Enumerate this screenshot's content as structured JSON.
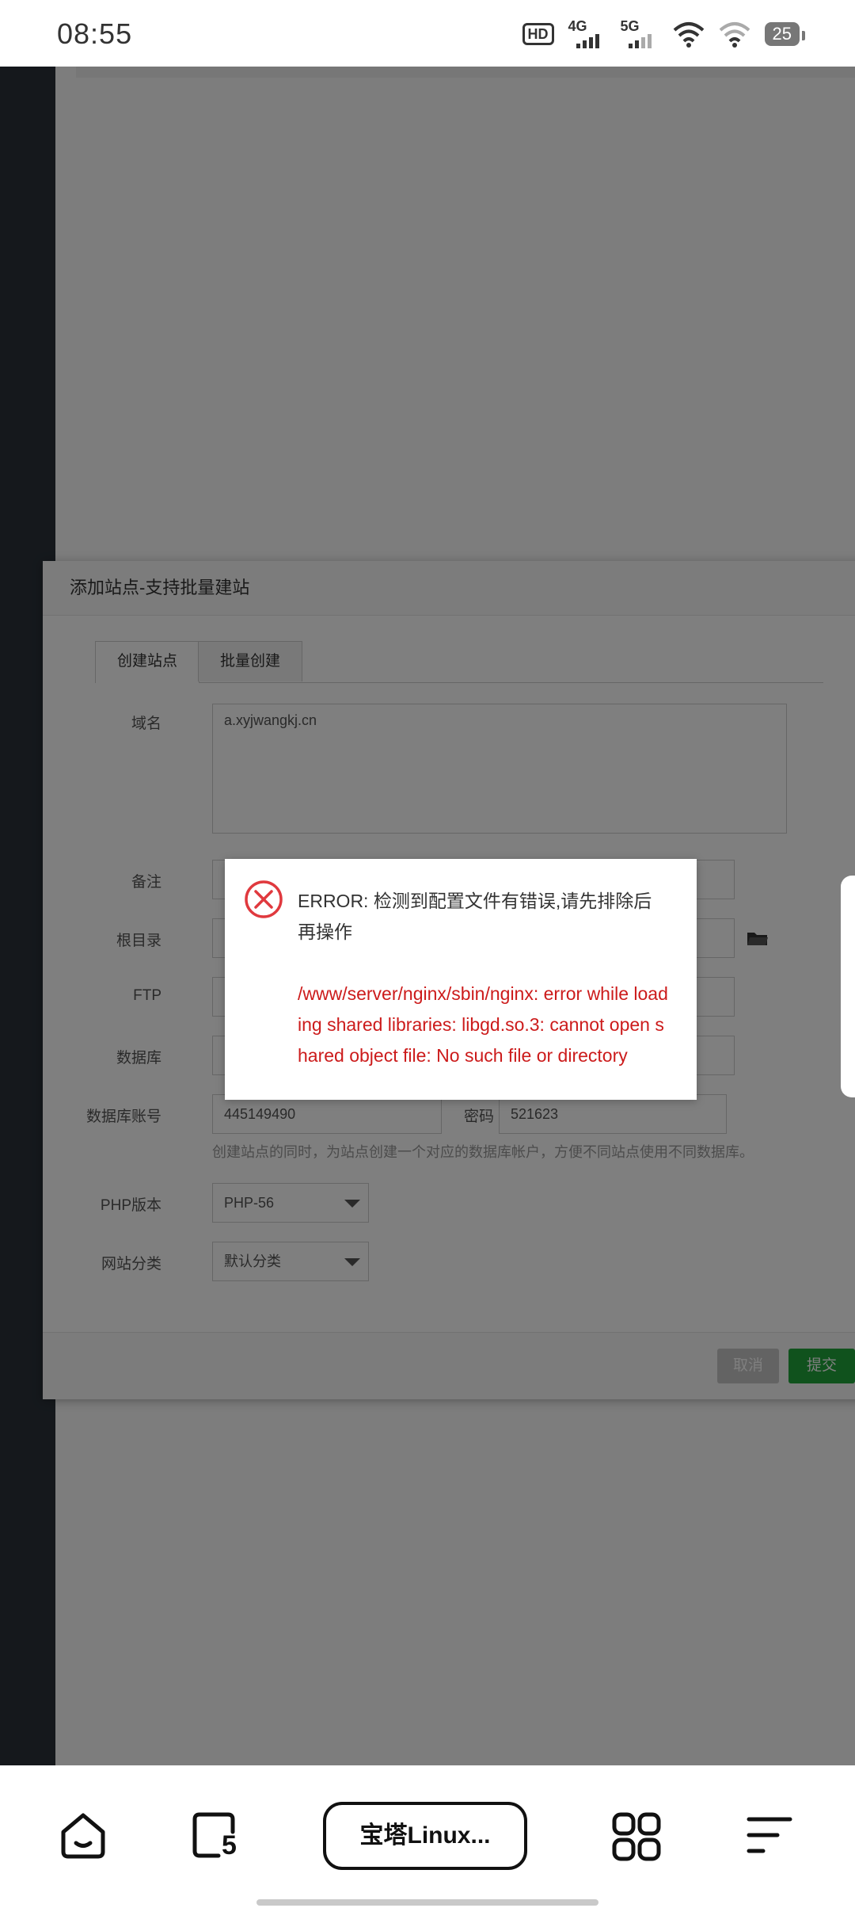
{
  "status_bar": {
    "time": "08:55",
    "hd_label": "HD",
    "net1": "4G",
    "net2": "5G",
    "battery": "25",
    "icons": [
      "hd-icon",
      "signal-4g-icon",
      "signal-5g-icon",
      "wifi-icon",
      "wifi-icon",
      "battery-icon"
    ]
  },
  "site_dialog": {
    "title": "添加站点-支持批量建站",
    "tabs": [
      {
        "label": "创建站点",
        "active": true
      },
      {
        "label": "批量创建",
        "active": false
      }
    ],
    "labels": {
      "domain": "域名",
      "note": "备注",
      "root": "根目录",
      "ftp": "FTP",
      "database": "数据库",
      "db_account": "数据库账号",
      "password": "密码",
      "php_version": "PHP版本",
      "category": "网站分类"
    },
    "values": {
      "domain": "a.xyjwangkj.cn",
      "db_account": "445149490",
      "password": "521623",
      "php_version": "PHP-56",
      "category": "默认分类"
    },
    "hint": "创建站点的同时，为站点创建一个对应的数据库帐户，方便不同站点使用不同数据库。",
    "buttons": {
      "cancel": "取消",
      "submit": "提交"
    }
  },
  "error_dialog": {
    "title": "ERROR: 检测到配置文件有错误,请先排除后再操作",
    "detail": "/www/server/nginx/sbin/nginx: error while loading shared libraries: libgd.so.3: cannot open shared object file: No such file or directory"
  },
  "bottom_nav": {
    "title_pill": "宝塔Linux...",
    "tab_count": "5"
  },
  "colors": {
    "accent_green": "#20a53a",
    "error_red": "#cc1b1b",
    "sidebar": "#2a3139"
  }
}
